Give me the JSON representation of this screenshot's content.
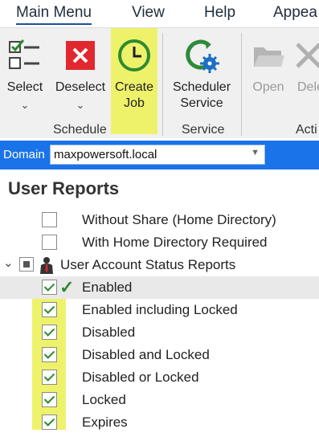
{
  "menu": {
    "tabs": [
      {
        "label": "Main Menu",
        "active": true
      },
      {
        "label": "View"
      },
      {
        "label": "Help"
      },
      {
        "label": "Appea"
      }
    ]
  },
  "ribbon": {
    "buttons": {
      "select": {
        "label": "Select",
        "icon": "checklist-icon"
      },
      "deselect": {
        "label": "Deselect",
        "icon": "red-x-icon"
      },
      "create_job": {
        "label_line1": "Create",
        "label_line2": "Job",
        "icon": "clock-icon"
      },
      "scheduler_service": {
        "label_line1": "Scheduler",
        "label_line2": "Service",
        "icon": "gear-refresh-icon"
      },
      "open": {
        "label": "Open",
        "icon": "folder-icon"
      },
      "delete": {
        "label": "Dele",
        "icon": "x-icon"
      }
    },
    "groups": {
      "schedule": "Schedule",
      "service": "Service",
      "actions": "Acti"
    },
    "highlight_color": "#eef26a"
  },
  "domain": {
    "label": "Domain",
    "value": "maxpowersoft.local"
  },
  "page": {
    "title": "User Reports"
  },
  "tree": {
    "items": [
      {
        "label": "Without Share (Home Directory)",
        "checked": false
      },
      {
        "label": "With Home Directory Required",
        "checked": false
      }
    ],
    "group": {
      "label": "User Account Status Reports",
      "expanded": true
    },
    "children": [
      {
        "label": "Enabled",
        "checked": true,
        "selected": true
      },
      {
        "label": "Enabled including Locked",
        "checked": true
      },
      {
        "label": "Disabled",
        "checked": true
      },
      {
        "label": "Disabled and Locked",
        "checked": true
      },
      {
        "label": "Disabled or Locked",
        "checked": true
      },
      {
        "label": "Locked",
        "checked": true
      },
      {
        "label": "Expires",
        "checked": true
      }
    ]
  },
  "colors": {
    "accent": "#1a73e8",
    "check_green": "#2d8a2d"
  }
}
